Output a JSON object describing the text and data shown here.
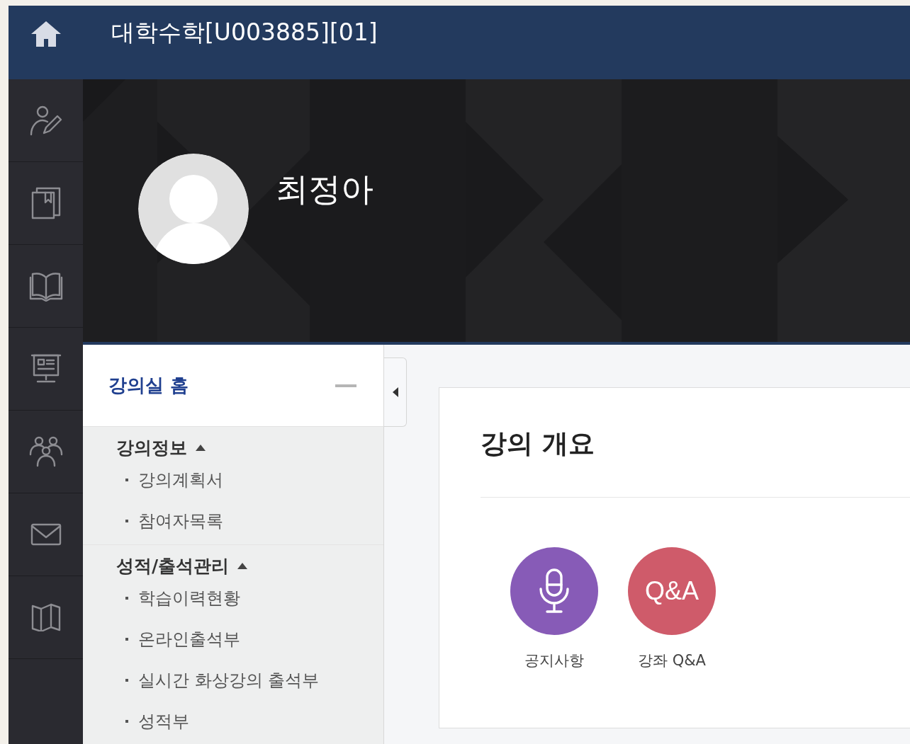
{
  "header": {
    "title": "대학수학[U003885][01]"
  },
  "rail": [
    {
      "kind": "profile"
    },
    {
      "kind": "books"
    },
    {
      "kind": "book"
    },
    {
      "kind": "board"
    },
    {
      "kind": "people"
    },
    {
      "kind": "mail"
    },
    {
      "kind": "map"
    }
  ],
  "profile": {
    "name": "최정아"
  },
  "sidebar": {
    "home": "강의실 홈",
    "sections": [
      {
        "title": "강의정보",
        "expanded": true,
        "items": [
          "강의계획서",
          "참여자목록"
        ]
      },
      {
        "title": "성적/출석관리",
        "expanded": true,
        "items": [
          "학습이력현황",
          "온라인출석부",
          "실시간 화상강의 출석부",
          "성적부"
        ]
      }
    ]
  },
  "main": {
    "title": "강의 개요",
    "shortcuts": [
      {
        "kind": "mic",
        "label": "공지사항",
        "color": "#875bb7"
      },
      {
        "kind": "text",
        "badge": "Q&A",
        "label": "강좌 Q&A",
        "color": "#cf5b6a"
      }
    ]
  }
}
